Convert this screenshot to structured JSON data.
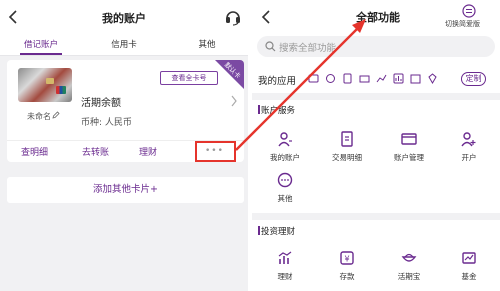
{
  "left": {
    "title": "我的账户",
    "tabs": [
      "借记账户",
      "信用卡",
      "其他"
    ],
    "card": {
      "name": "未命名",
      "show_full_label": "查看全卡号",
      "default_flag": "默认卡",
      "balance_label": "活期余额",
      "currency_label": "币种: 人民币",
      "actions": [
        "查明细",
        "去转账",
        "理财"
      ],
      "more_dots": "•••"
    },
    "add_card_label": "添加其他卡片+"
  },
  "right": {
    "title": "全部功能",
    "switch_label": "切换简爱版",
    "search_placeholder": "搜索全部功能",
    "my_apps_label": "我的应用",
    "custom_label": "定制",
    "sections": [
      {
        "title": "账户服务",
        "items": [
          {
            "label": "我的账户",
            "icon": "person-icon"
          },
          {
            "label": "交易明细",
            "icon": "receipt-icon"
          },
          {
            "label": "账户管理",
            "icon": "card-manage-icon"
          },
          {
            "label": "开户",
            "icon": "add-person-icon"
          },
          {
            "label": "其他",
            "icon": "more-icon"
          }
        ]
      },
      {
        "title": "投资理财",
        "items": [
          {
            "label": "理财",
            "icon": "chart-icon"
          },
          {
            "label": "存款",
            "icon": "deposit-icon"
          },
          {
            "label": "活期宝",
            "icon": "treasure-icon"
          },
          {
            "label": "基金",
            "icon": "fund-icon"
          }
        ]
      }
    ]
  },
  "colors": {
    "brand_purple": "#6a2a8f",
    "annotation_red": "#e5342c",
    "background_gray": "#f1f1f3"
  }
}
